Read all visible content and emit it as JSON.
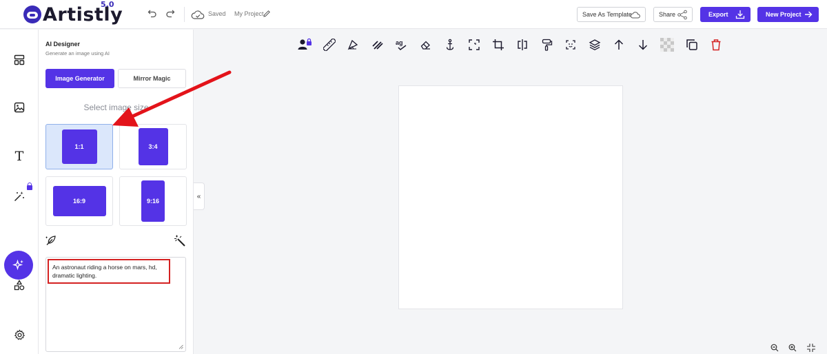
{
  "header": {
    "logo_text": "Artistly",
    "logo_version": "5.0",
    "saved_label": "Saved",
    "project_name": "My Project",
    "save_as_template_label": "Save As Template",
    "share_label": "Share",
    "export_label": "Export",
    "new_project_label": "New Project"
  },
  "sidebar": {
    "items": [
      {
        "name": "layout-icon"
      },
      {
        "name": "image-icon"
      },
      {
        "name": "text-icon",
        "glyph": "T"
      },
      {
        "name": "magic-wand-icon"
      },
      {
        "name": "ai-sparkle-icon",
        "active": true
      },
      {
        "name": "shapes-icon"
      },
      {
        "name": "settings-icon"
      }
    ]
  },
  "panel": {
    "title": "AI Designer",
    "subtitle": "Generate an image using AI",
    "tabs": [
      {
        "label": "Image Generator",
        "active": true
      },
      {
        "label": "Mirror Magic",
        "active": false
      }
    ],
    "select_size_label": "Select image size",
    "sizes": [
      {
        "label": "1:1",
        "selected": true
      },
      {
        "label": "3:4",
        "selected": false
      },
      {
        "label": "16:9",
        "selected": false
      },
      {
        "label": "9:16",
        "selected": false
      }
    ],
    "prompt_text": "An astronaut riding a horse on mars, hd, dramatic lighting.",
    "collapse_glyph": "«"
  },
  "toolbar": {
    "tools": [
      "user-lock-icon",
      "ruler-icon",
      "shadow-icon",
      "stripes-icon",
      "spellcheck-icon",
      "eraser-icon",
      "anchor-icon",
      "resize-icon",
      "crop-icon",
      "flip-icon",
      "paint-roller-icon",
      "focus-icon",
      "layers-icon",
      "arrow-up-icon",
      "arrow-down-icon",
      "transparency-icon",
      "duplicate-icon",
      "delete-icon"
    ]
  },
  "colors": {
    "accent": "#5433e6",
    "danger": "#d42121",
    "selected_bg": "#dbe7fb"
  }
}
